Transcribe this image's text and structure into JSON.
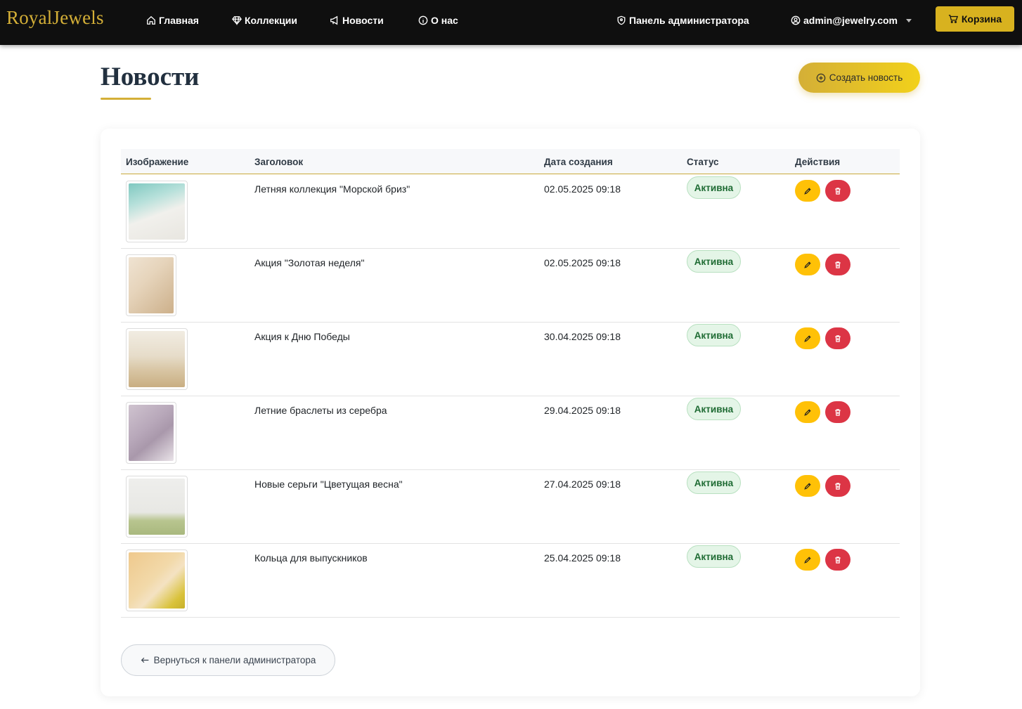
{
  "navbar": {
    "brand": "RoyalJewels",
    "home": "Главная",
    "collections": "Коллекции",
    "news": "Новости",
    "about": "О нас",
    "admin_panel": "Панель администратора",
    "user": "admin@jewelry.com",
    "cart": "Корзина"
  },
  "header": {
    "title": "Новости",
    "create_button": "Создать новость"
  },
  "table": {
    "columns": {
      "image": "Изображение",
      "title": "Заголовок",
      "date": "Дата создания",
      "status": "Статус",
      "actions": "Действия"
    },
    "rows": [
      {
        "title": "Летняя коллекция \"Морской бриз\"",
        "date": "02.05.2025 09:18",
        "status": "Активна"
      },
      {
        "title": "Акция \"Золотая неделя\"",
        "date": "02.05.2025 09:18",
        "status": "Активна"
      },
      {
        "title": "Акция к Дню Победы",
        "date": "30.04.2025 09:18",
        "status": "Активна"
      },
      {
        "title": "Летние браслеты из серебра",
        "date": "29.04.2025 09:18",
        "status": "Активна"
      },
      {
        "title": "Новые серьги \"Цветущая весна\"",
        "date": "27.04.2025 09:18",
        "status": "Активна"
      },
      {
        "title": "Кольца для выпускников",
        "date": "25.04.2025 09:18",
        "status": "Активна"
      }
    ]
  },
  "back_button": "Вернуться к панели администратора",
  "colors": {
    "gold": "#d4af37",
    "navbar_bg": "#0f0f0f",
    "edit": "#ffc107",
    "delete": "#dc3545",
    "status_active_bg": "#e4f5e7",
    "status_active_text": "#1e6b33"
  },
  "icons": {
    "home": "house-icon",
    "collections": "gem-icon",
    "news": "megaphone-icon",
    "about": "info-circle-icon",
    "admin": "shield-icon",
    "user": "user-circle-icon",
    "cart": "cart-icon",
    "create": "plus-circle-icon",
    "edit": "pencil-icon",
    "delete": "trash-icon",
    "back": "arrow-left-icon"
  }
}
